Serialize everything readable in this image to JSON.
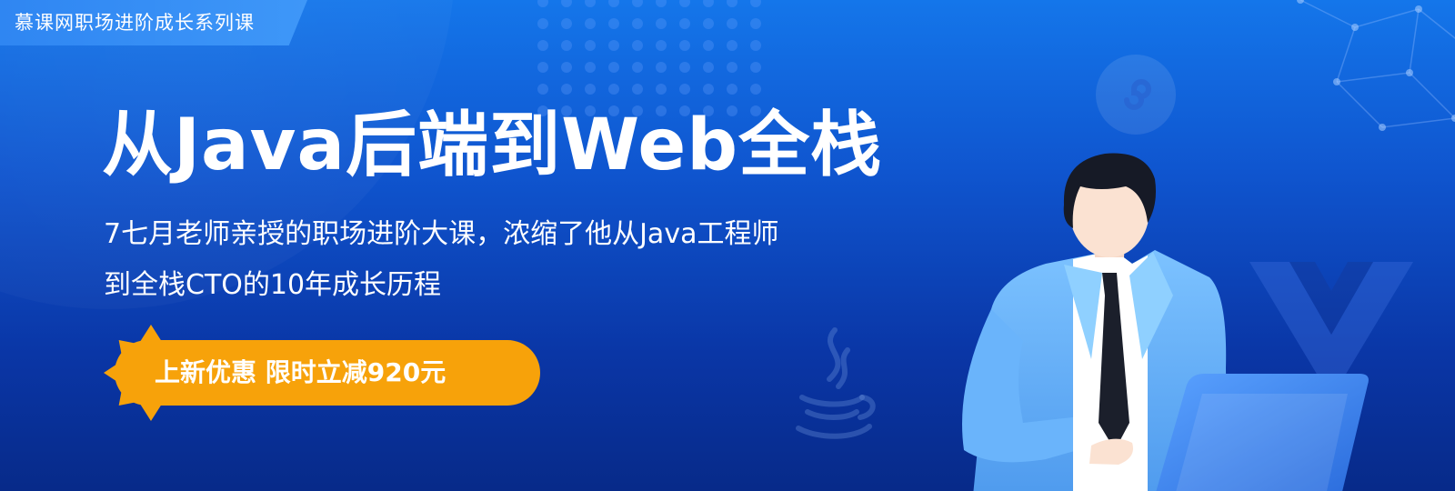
{
  "tag": {
    "label": "慕课网职场进阶成长系列课"
  },
  "hero": {
    "title": "从Java后端到Web全栈",
    "subtitle_line1": "7七月老师亲授的职场进阶大课，浓缩了他从Java工程师",
    "subtitle_line2": "到全栈CTO的10年成长历程"
  },
  "promo": {
    "label": "上新优惠  限时立减920元"
  },
  "icons": [
    "dot-grid-decoration",
    "network-decoration",
    "mini-program-icon",
    "vue-logo-icon",
    "java-logo-icon",
    "person-illustration"
  ],
  "colors": {
    "background_top": "#1476ea",
    "background_bottom": "#072a89",
    "ribbon": "#3e97f8",
    "promo": "#f7a20a",
    "text": "#ffffff"
  }
}
